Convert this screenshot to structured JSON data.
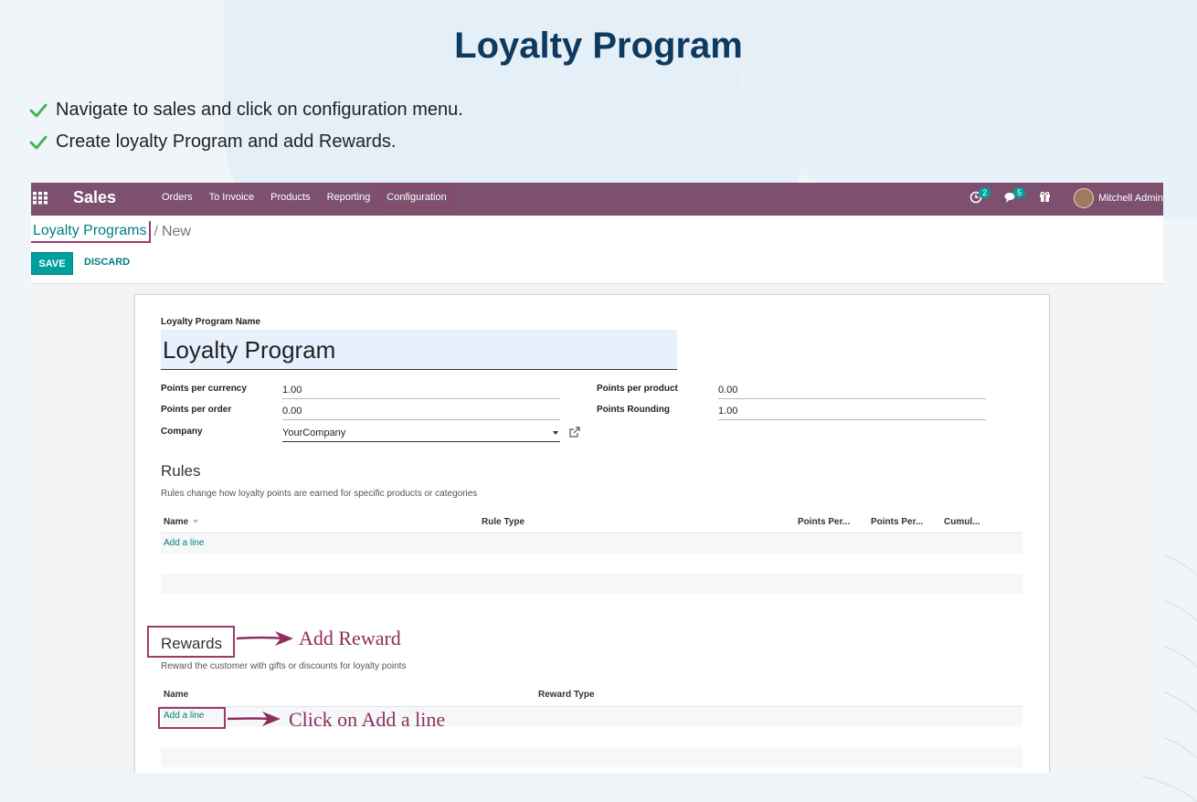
{
  "slide": {
    "title": "Loyalty Program",
    "bullets": [
      "Navigate to sales and click on configuration menu.",
      "Create loyalty Program and add Rewards."
    ],
    "colors": {
      "title": "#0f3a5f",
      "check": "#3bb54a",
      "annotation": "#8c2f5f"
    }
  },
  "navbar": {
    "app_name": "Sales",
    "menu": [
      "Orders",
      "To Invoice",
      "Products",
      "Reporting",
      "Configuration"
    ],
    "activity_badge": "2",
    "messages_badge": "5",
    "user": "Mitchell Admin",
    "color": "#7c506e"
  },
  "breadcrumb": {
    "parent": "Loyalty Programs",
    "separator": "/",
    "current": "New"
  },
  "buttons": {
    "save": "SAVE",
    "discard": "DISCARD"
  },
  "form": {
    "name_label": "Loyalty Program Name",
    "name_value": "Loyalty Program",
    "points_per_currency_label": "Points per currency",
    "points_per_currency_value": "1.00",
    "points_per_order_label": "Points per order",
    "points_per_order_value": "0.00",
    "company_label": "Company",
    "company_value": "YourCompany",
    "points_per_product_label": "Points per product",
    "points_per_product_value": "0.00",
    "points_rounding_label": "Points Rounding",
    "points_rounding_value": "1.00"
  },
  "rules": {
    "title": "Rules",
    "description": "Rules change how loyalty points are earned for specific products or categories",
    "columns": [
      "Name",
      "Rule Type",
      "Points Per...",
      "Points Per...",
      "Cumul..."
    ],
    "add_line": "Add a line"
  },
  "rewards": {
    "title": "Rewards",
    "description": "Reward the customer with gifts or discounts for loyalty points",
    "columns": [
      "Name",
      "Reward Type"
    ],
    "add_line": "Add a line"
  },
  "annotations": {
    "add_reward": "Add Reward",
    "click_add_line": "Click on Add a line"
  }
}
